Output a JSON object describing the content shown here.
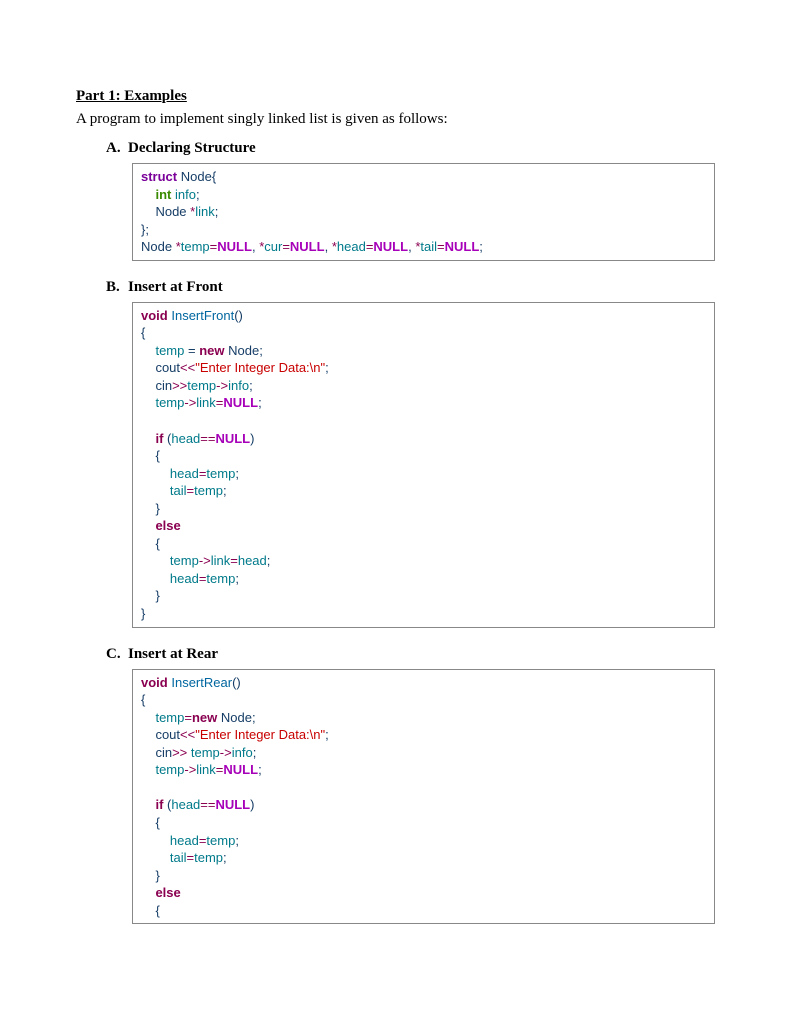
{
  "title": "Part 1: Examples",
  "intro": "A program to implement singly linked list is given as follows:",
  "sections": {
    "a": {
      "letter": "A.",
      "heading": "Declaring Structure"
    },
    "b": {
      "letter": "B.",
      "heading": "Insert at Front"
    },
    "c": {
      "letter": "C.",
      "heading": "Insert at Rear"
    }
  },
  "code": {
    "a": {
      "struct": "struct",
      "node": "Node",
      "lbrace": "{",
      "int": "int",
      "info": "info",
      "semi": ";",
      "node2": "Node",
      "star": "*",
      "link": "link",
      "rbrace_semi": "};",
      "decl_node": "Node",
      "decl_star1": "*",
      "temp": "temp",
      "eq": "=",
      "null1": "NULL",
      "c1": ",",
      "sp": " ",
      "star2": "*",
      "cur": "cur",
      "null2": "NULL",
      "c2": ",",
      "star3": "*",
      "head": "head",
      "null3": "NULL",
      "c3": ",",
      "star4": "*",
      "tail": "tail",
      "null4": "NULL"
    },
    "b": {
      "void": "void",
      "fn": "InsertFront",
      "paren": "()",
      "lbrace": "{",
      "temp1": "temp",
      "eq": " = ",
      "new": "new",
      "sp": " ",
      "node": "Node",
      "semi": ";",
      "cout": "cout",
      "lsh": "<<",
      "str": "\"Enter Integer Data:\\n\"",
      "cin": "cin",
      "rsh": ">>",
      "temp2": "temp",
      "arrow": "->",
      "info": "info",
      "temp3": "temp",
      "link": "link",
      "null": "NULL",
      "if": "if",
      "lparen": " (",
      "head1": "head",
      "eqeq": "==",
      "rparen": ")",
      "lbrace2": "{",
      "head2": "head",
      "eq2": "=",
      "temp4": "temp",
      "tail1": "tail",
      "temp5": "temp",
      "rbrace2": "}",
      "else": "else",
      "lbrace3": "{",
      "temp6": "temp",
      "link2": "link",
      "head3": "head",
      "head4": "head",
      "temp7": "temp",
      "rbrace3": "}",
      "rbrace": "}"
    },
    "c": {
      "void": "void",
      "fn": "InsertRear",
      "paren": "()",
      "lbrace": "{",
      "temp1": "temp",
      "eq": "=",
      "new": "new",
      "sp": " ",
      "node": "Node",
      "semi": ";",
      "cout": "cout",
      "lsh": "<<",
      "str": "\"Enter Integer Data:\\n\"",
      "cin": "cin",
      "rsh": ">>",
      "temp2": "temp",
      "arrow": "->",
      "info": "info",
      "temp3": "temp",
      "link": "link",
      "null": "NULL",
      "if": "if",
      "lparen": " (",
      "head1": "head",
      "eqeq": "==",
      "rparen": ")",
      "lbrace2": "{",
      "head2": "head",
      "eq2": "=",
      "temp4": "temp",
      "tail1": "tail",
      "temp5": "temp",
      "rbrace2": "}",
      "else": "else",
      "lbrace3": "{"
    }
  }
}
